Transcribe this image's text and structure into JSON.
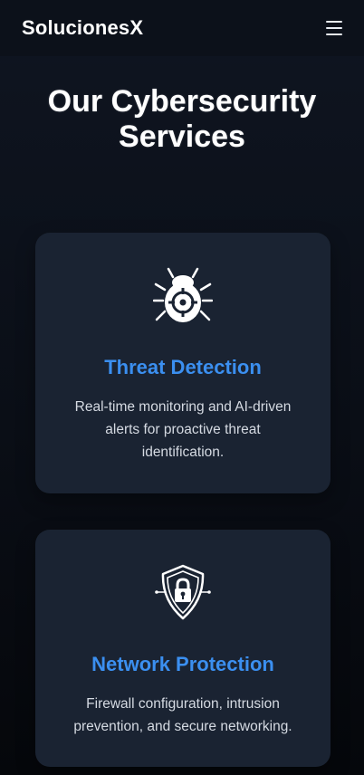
{
  "nav": {
    "brand": "SolucionesX",
    "menu_icon": "hamburger-menu-icon"
  },
  "hero": {
    "title": "Our Cybersecurity Services"
  },
  "services": [
    {
      "icon": "bug-target-icon",
      "title": "Threat Detection",
      "description": "Real-time monitoring and AI-driven alerts for proactive threat identification."
    },
    {
      "icon": "shield-lock-icon",
      "title": "Network Protection",
      "description": "Firewall configuration, intrusion prevention, and secure networking."
    }
  ],
  "colors": {
    "background": "#0a0e16",
    "card": "#1a2332",
    "accent": "#3b8ff0",
    "text": "#d5dae2"
  }
}
